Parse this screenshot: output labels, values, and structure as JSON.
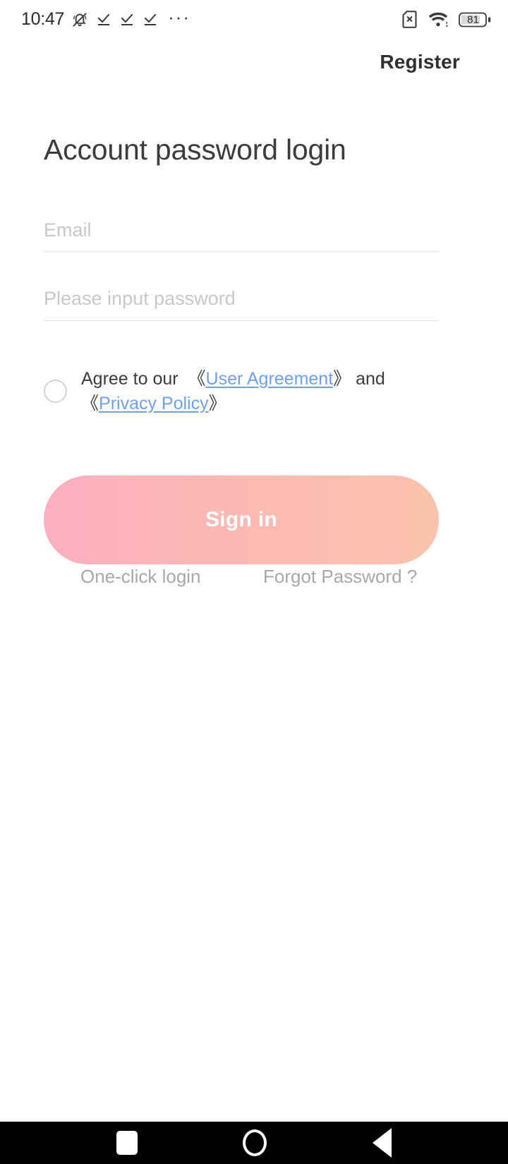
{
  "status_bar": {
    "time": "10:47",
    "battery_level": "81",
    "icons": [
      "bell-muted-icon",
      "download-complete-icon",
      "download-complete-icon",
      "download-complete-icon",
      "more-dots-icon",
      "sim-card-error-icon",
      "wifi-icon",
      "battery-icon"
    ],
    "more_dots": "···"
  },
  "header": {
    "register_label": "Register"
  },
  "main": {
    "title": "Account password login",
    "email_field": {
      "placeholder": "Email",
      "value": ""
    },
    "password_field": {
      "placeholder": "Please input password",
      "value": ""
    },
    "agreement": {
      "checked": false,
      "prefix": "Agree to our",
      "bracket_open": "《",
      "bracket_close": "》",
      "user_agreement_label": "User Agreement",
      "conjunction": "and",
      "privacy_policy_label": "Privacy Policy"
    },
    "signin_label": "Sign in",
    "one_click_login_label": "One-click login",
    "forgot_password_label": "Forgot Password ?"
  },
  "nav_bar": {
    "recents_label": "recents-square-icon",
    "home_label": "home-circle-icon",
    "back_label": "back-triangle-icon"
  },
  "colors": {
    "accent_gradient_start": "#fbafbf",
    "accent_gradient_end": "#fbc3ad",
    "link_blue": "#6fa0f0",
    "placeholder_grey": "#c8c8c8",
    "text_dark": "#3c3c3c",
    "muted_grey": "#a8a8a8"
  }
}
